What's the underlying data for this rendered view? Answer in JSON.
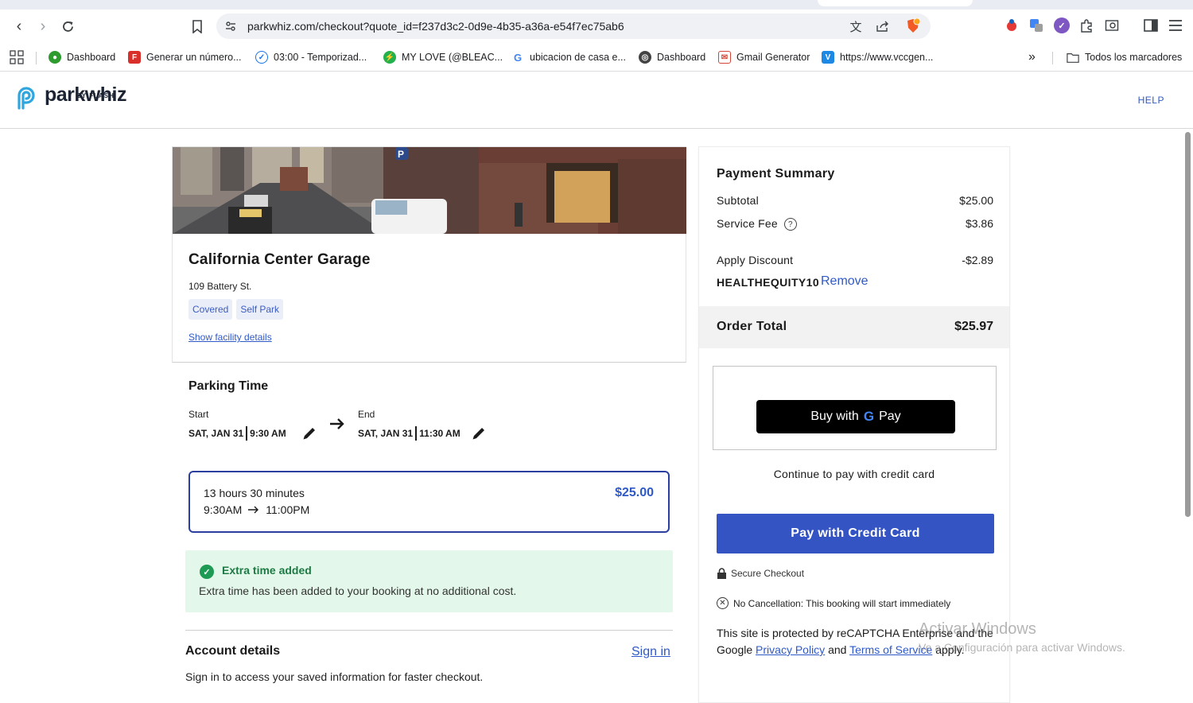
{
  "browser": {
    "url": "parkwhiz.com/checkout?quote_id=f237d3c2-0d9e-4b35-a36a-e54f7ec75ab6",
    "bookmarks": [
      {
        "label": "Dashboard",
        "icon": "dashboard-favicon",
        "color": "#2e9b2e"
      },
      {
        "label": "Generar un número...",
        "icon": "f-favicon",
        "color": "#d9302c"
      },
      {
        "label": "03:00 - Temporizad...",
        "icon": "timer-favicon",
        "color": "#1a73e8"
      },
      {
        "label": "MY LOVE (@BLEAC...",
        "icon": "lightning-favicon",
        "color": "#22b14c"
      },
      {
        "label": "ubicacion de casa e...",
        "icon": "google-favicon",
        "color": "#4285f4"
      },
      {
        "label": "Dashboard",
        "icon": "globe-favicon",
        "color": "#444444"
      },
      {
        "label": "Gmail Generator",
        "icon": "gmail-generator-favicon",
        "color": "#d44638"
      },
      {
        "label": "https://www.vccgen...",
        "icon": "v-favicon",
        "color": "#1e88e5"
      }
    ],
    "all_bookmarks": "Todos los marcadores",
    "more": "»",
    "badge_count": "8"
  },
  "site": {
    "logo_text": "parkwhiz",
    "logo_sub": "BY FLASH",
    "help": "HELP"
  },
  "facility": {
    "name": "California Center Garage",
    "address": "109 Battery St.",
    "tags": [
      "Covered",
      "Self Park"
    ],
    "details_link": "Show facility details"
  },
  "parking_time": {
    "title": "Parking Time",
    "start_label": "Start",
    "start_date": "SAT, JAN 31",
    "start_time": "9:30 AM",
    "end_label": "End",
    "end_date": "SAT, JAN 31",
    "end_time": "11:30 AM",
    "option": {
      "duration": "13 hours 30 minutes",
      "from": "9:30AM",
      "to": "11:00PM",
      "price": "$25.00"
    }
  },
  "extra_time": {
    "title": "Extra time added",
    "description": "Extra time has been added to your booking at no additional cost."
  },
  "account": {
    "title": "Account details",
    "sign_in": "Sign in",
    "description": "Sign in to access your saved information for faster checkout."
  },
  "payment": {
    "title": "Payment Summary",
    "subtotal_label": "Subtotal",
    "subtotal": "$25.00",
    "service_fee_label": "Service Fee",
    "service_fee": "$3.86",
    "discount_label": "Apply Discount",
    "discount": "-$2.89",
    "discount_code": "HEALTHEQUITY10",
    "remove": "Remove",
    "total_label": "Order Total",
    "total": "$25.97",
    "gpay_prefix": "Buy with",
    "gpay_g": "G",
    "gpay_suffix": "Pay",
    "continue_text": "Continue to pay with credit card",
    "pay_button": "Pay with Credit Card",
    "secure": "Secure Checkout",
    "no_cancel": "No Cancellation: This booking will start immediately",
    "recaptcha_1": "This site is protected by reCAPTCHA Enterprise and the Google",
    "privacy": "Privacy Policy",
    "and": "and",
    "terms": "Terms of Service",
    "apply": "apply."
  },
  "watermark": {
    "line1": "Activar Windows",
    "line2": "Ve a Configuración para activar Windows."
  }
}
